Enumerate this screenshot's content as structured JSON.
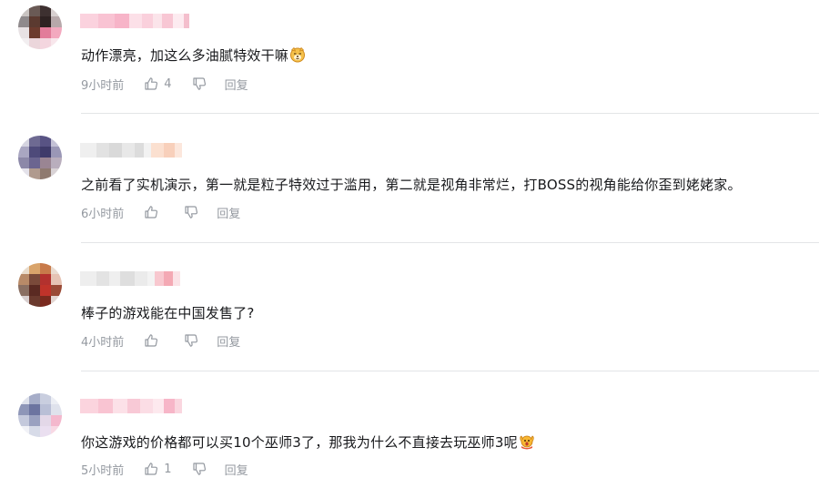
{
  "comments": [
    {
      "time": "9小时前",
      "text": "动作漂亮，加这么多油腻特效干嘛",
      "emoji": "dog-face-emoji",
      "likes": "4",
      "reply": "回复"
    },
    {
      "time": "6小时前",
      "text": "之前看了实机演示，第一就是粒子特效过于滥用，第二就是视角非常烂，打BOSS的视角能给你歪到姥姥家。",
      "emoji": "",
      "likes": "",
      "reply": "回复"
    },
    {
      "time": "4小时前",
      "text": "棒子的游戏能在中国发售了?",
      "emoji": "",
      "likes": "",
      "reply": "回复"
    },
    {
      "time": "5小时前",
      "text": "你这游戏的价格都可以买10个巫师3了，那我为什么不直接去玩巫师3呢",
      "emoji": "shocked-face-emoji",
      "likes": "1",
      "reply": "回复"
    }
  ],
  "colors": {
    "text": "#18191c",
    "meta": "#9499a0",
    "divider": "#e3e5e7"
  }
}
